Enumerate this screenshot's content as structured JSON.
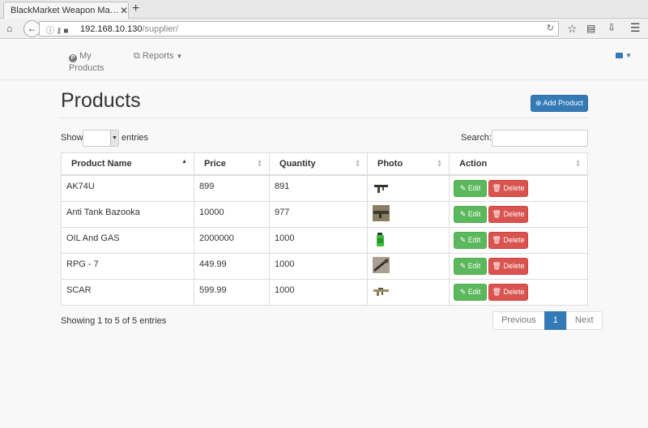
{
  "browser": {
    "tab_title": "BlackMarket Weapon Ma…",
    "tab_close": "✕",
    "new_tab": "+",
    "url_host": "192.168.10.130",
    "url_path": "/supplier/"
  },
  "nav": {
    "my_products_icon": "P",
    "my_products_line1": "My",
    "my_products_line2": "Products",
    "reports_label": "Reports",
    "account_icon": "lock-icon"
  },
  "page": {
    "title": "Products",
    "add_product": "Add Product",
    "show": "Show",
    "entries": "entries",
    "search_label": "Search:",
    "search_value": "",
    "length_value": ""
  },
  "table": {
    "headers": [
      "Product Name",
      "Price",
      "Quantity",
      "Photo",
      "Action"
    ],
    "rows": [
      {
        "name": "AK74U",
        "price": "899",
        "quantity": "891",
        "photo": "ak74u-thumbnail"
      },
      {
        "name": "Anti Tank Bazooka",
        "price": "10000",
        "quantity": "977",
        "photo": "bazooka-thumbnail"
      },
      {
        "name": "OIL And GAS",
        "price": "2000000",
        "quantity": "1000",
        "photo": "gas-can-thumbnail"
      },
      {
        "name": "RPG - 7",
        "price": "449.99",
        "quantity": "1000",
        "photo": "rpg7-thumbnail"
      },
      {
        "name": "SCAR",
        "price": "599.99",
        "quantity": "1000",
        "photo": "scar-thumbnail"
      }
    ],
    "edit_label": "Edit",
    "delete_label": "Delete"
  },
  "footer": {
    "info": "Showing 1 to 5 of 5 entries",
    "previous": "Previous",
    "current_page": "1",
    "next": "Next"
  },
  "colors": {
    "primary": "#337ab7",
    "success": "#5cb85c",
    "danger": "#d9534f"
  }
}
